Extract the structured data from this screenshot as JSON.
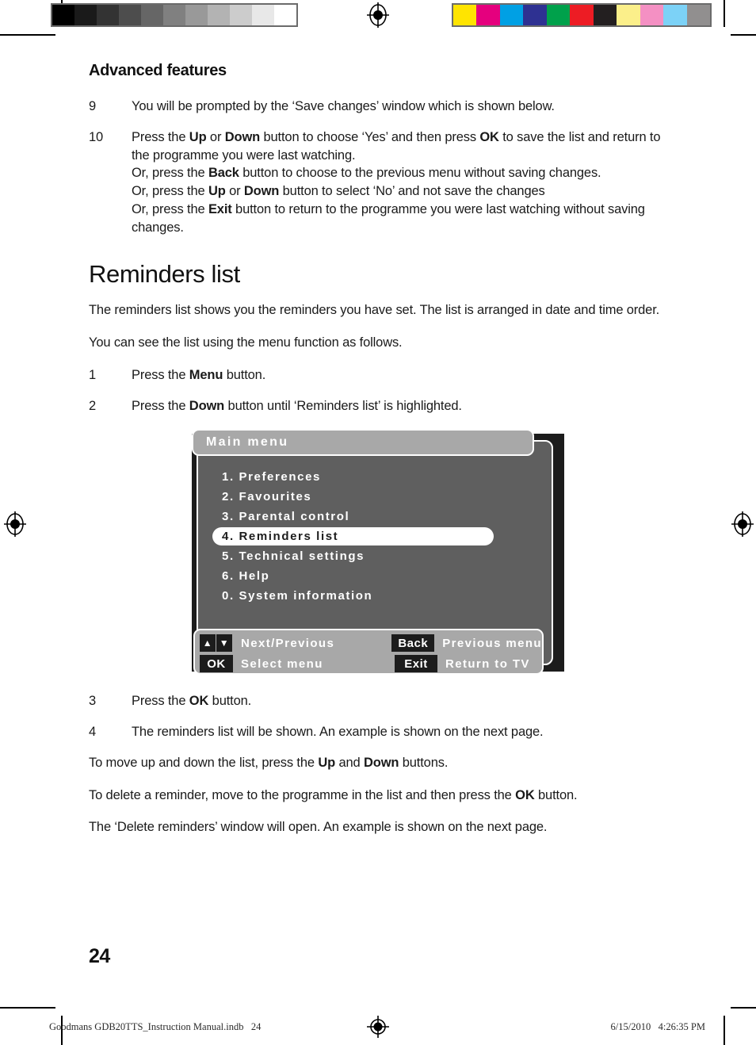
{
  "print_marks": {
    "gray_bar": {
      "name": "grayscale-calibration-bar",
      "swatches": [
        "#000000",
        "#1a1a1a",
        "#333333",
        "#4d4d4d",
        "#666666",
        "#808080",
        "#999999",
        "#b3b3b3",
        "#cccccc",
        "#e8e8e8",
        "#ffffff"
      ]
    },
    "color_bar": {
      "name": "color-calibration-bar",
      "swatches": [
        "#ffe400",
        "#e5007e",
        "#00a0e4",
        "#2e3192",
        "#00a14b",
        "#ed1c24",
        "#231f20",
        "#fbef8a",
        "#f490c3",
        "#7cd2f7",
        "#918f8f"
      ]
    }
  },
  "content": {
    "section_title": "Advanced features",
    "steps_top": [
      {
        "num": "9",
        "lines": [
          [
            {
              "t": "You will be prompted by the ‘Save changes’ window which is shown below.",
              "b": false
            }
          ]
        ]
      },
      {
        "num": "10",
        "lines": [
          [
            {
              "t": "Press the ",
              "b": false
            },
            {
              "t": "Up",
              "b": true
            },
            {
              "t": " or ",
              "b": false
            },
            {
              "t": "Down",
              "b": true
            },
            {
              "t": " button to choose ‘Yes’ and then press ",
              "b": false
            },
            {
              "t": "OK",
              "b": true
            },
            {
              "t": " to save the list and return to the programme you were last watching.",
              "b": false
            }
          ],
          [
            {
              "t": "Or, press the ",
              "b": false
            },
            {
              "t": "Back",
              "b": true
            },
            {
              "t": " button to choose to the previous menu without saving changes.",
              "b": false
            }
          ],
          [
            {
              "t": "Or, press the ",
              "b": false
            },
            {
              "t": "Up",
              "b": true
            },
            {
              "t": " or ",
              "b": false
            },
            {
              "t": "Down",
              "b": true
            },
            {
              "t": " button to select ‘No’ and not save the changes",
              "b": false
            }
          ],
          [
            {
              "t": "Or, press the ",
              "b": false
            },
            {
              "t": "Exit",
              "b": true
            },
            {
              "t": " button to return to the programme you were last watching without saving changes.",
              "b": false
            }
          ]
        ]
      }
    ],
    "big_title": "Reminders list",
    "intro_paragraph": "The reminders list shows you the reminders you have set. The list is arranged in date and time order.",
    "how_to_paragraph": "You can see the list using the menu function as follows.",
    "steps_mid": [
      {
        "num": "1",
        "lines": [
          [
            {
              "t": "Press the ",
              "b": false
            },
            {
              "t": "Menu",
              "b": true
            },
            {
              "t": " button.",
              "b": false
            }
          ]
        ]
      },
      {
        "num": "2",
        "lines": [
          [
            {
              "t": "Press the ",
              "b": false
            },
            {
              "t": "Down",
              "b": true
            },
            {
              "t": " button until ‘Reminders list’ is highlighted.",
              "b": false
            }
          ]
        ]
      }
    ],
    "steps_bottom": [
      {
        "num": "3",
        "lines": [
          [
            {
              "t": "Press the ",
              "b": false
            },
            {
              "t": "OK",
              "b": true
            },
            {
              "t": " button.",
              "b": false
            }
          ]
        ]
      },
      {
        "num": "4",
        "lines": [
          [
            {
              "t": "The reminders list will be shown. An example is shown on the next page.",
              "b": false
            }
          ]
        ]
      }
    ],
    "closing_paragraphs": [
      [
        {
          "t": "To move up and down the list, press the ",
          "b": false
        },
        {
          "t": "Up",
          "b": true
        },
        {
          "t": " and ",
          "b": false
        },
        {
          "t": "Down",
          "b": true
        },
        {
          "t": " buttons.",
          "b": false
        }
      ],
      [
        {
          "t": "To delete a reminder, move to the programme in the list and then press the ",
          "b": false
        },
        {
          "t": "OK",
          "b": true
        },
        {
          "t": " button.",
          "b": false
        }
      ],
      [
        {
          "t": "The ‘Delete reminders’ window will open. An example is shown on the next page.",
          "b": false
        }
      ]
    ]
  },
  "osd": {
    "title": "Main menu",
    "items": [
      {
        "label": "1. Preferences",
        "selected": false
      },
      {
        "label": "2. Favourites",
        "selected": false
      },
      {
        "label": "3. Parental control",
        "selected": false
      },
      {
        "label": "4. Reminders list",
        "selected": true
      },
      {
        "label": "5. Technical settings",
        "selected": false
      },
      {
        "label": "6. Help",
        "selected": false
      },
      {
        "label": "0. System information",
        "selected": false
      }
    ],
    "footer": {
      "row1": {
        "key_up": "▲",
        "key_down": "▼",
        "label_a": "Next/Previous",
        "key_b": "Back",
        "label_b": "Previous menu"
      },
      "row2": {
        "key_a": "OK",
        "label_a": "Select menu",
        "key_b": "Exit",
        "label_b": "Return to TV"
      }
    },
    "colors": {
      "panel_bg": "#5f5f5f",
      "titlebar_bg": "#a8a8a8",
      "outer_bg": "#1c1c1c",
      "highlight_bg": "#ffffff"
    }
  },
  "page_number": "24",
  "doc_footer": {
    "file_info": "Goodmans GDB20TTS_Instruction Manual.indb   24",
    "timestamp": "6/15/2010   4:26:35 PM"
  }
}
